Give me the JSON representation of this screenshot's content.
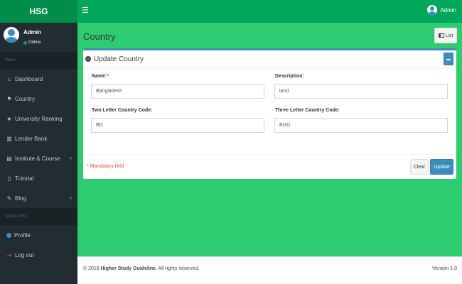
{
  "brand": "HSG",
  "header": {
    "menu_icon": "hamburger-icon",
    "user_name": "Admin"
  },
  "sidebar": {
    "user": {
      "name": "Admin",
      "status": "Online"
    },
    "menu_header": "Menu",
    "items": [
      {
        "label": "Dashboard",
        "icon": "dashboard-icon",
        "glyph": "⌂"
      },
      {
        "label": "Country",
        "icon": "flag-icon",
        "glyph": "⚑"
      },
      {
        "label": "University Ranking",
        "icon": "star-icon",
        "glyph": "★"
      },
      {
        "label": "Lender Bank",
        "icon": "bank-icon",
        "glyph": "▥"
      },
      {
        "label": "Institute & Course",
        "icon": "book-icon",
        "glyph": "▤",
        "chevron": "‹"
      },
      {
        "label": "Tutorial",
        "icon": "file-icon",
        "glyph": "▯"
      },
      {
        "label": "Blog",
        "icon": "edit-icon",
        "glyph": "✎",
        "chevron": "‹"
      }
    ],
    "quick_links_header": "Quick Links",
    "quick_links": [
      {
        "label": "Profile",
        "icon": "profile-icon"
      },
      {
        "label": "Log out",
        "icon": "logout-icon",
        "glyph": "⇥"
      }
    ]
  },
  "page": {
    "title": "Country",
    "list_button": "List"
  },
  "form": {
    "title": "Update Country",
    "name_label": "Name:",
    "name_required": "*",
    "name_value": "Bangladesh",
    "description_label": "Description:",
    "description_value": "land",
    "two_letter_label": "Two Letter Country Code:",
    "two_letter_value": "BD",
    "three_letter_label": "Three Letter Country Code:",
    "three_letter_value": "BGD",
    "mandatory_note": "* Mandatory field",
    "clear_button": "Clear",
    "update_button": "Update"
  },
  "footer": {
    "copyright_prefix": "© 2018 ",
    "copyright_brand": "Higher Study Guideline",
    "copyright_suffix": ". All rights reserved.",
    "version": "Version 1.0"
  },
  "colors": {
    "header": "#00a65a",
    "logo": "#008d4c",
    "sidebar": "#222d32",
    "content_bg": "#2ecc71",
    "primary": "#3c8dbc",
    "danger": "#dd4b39"
  }
}
